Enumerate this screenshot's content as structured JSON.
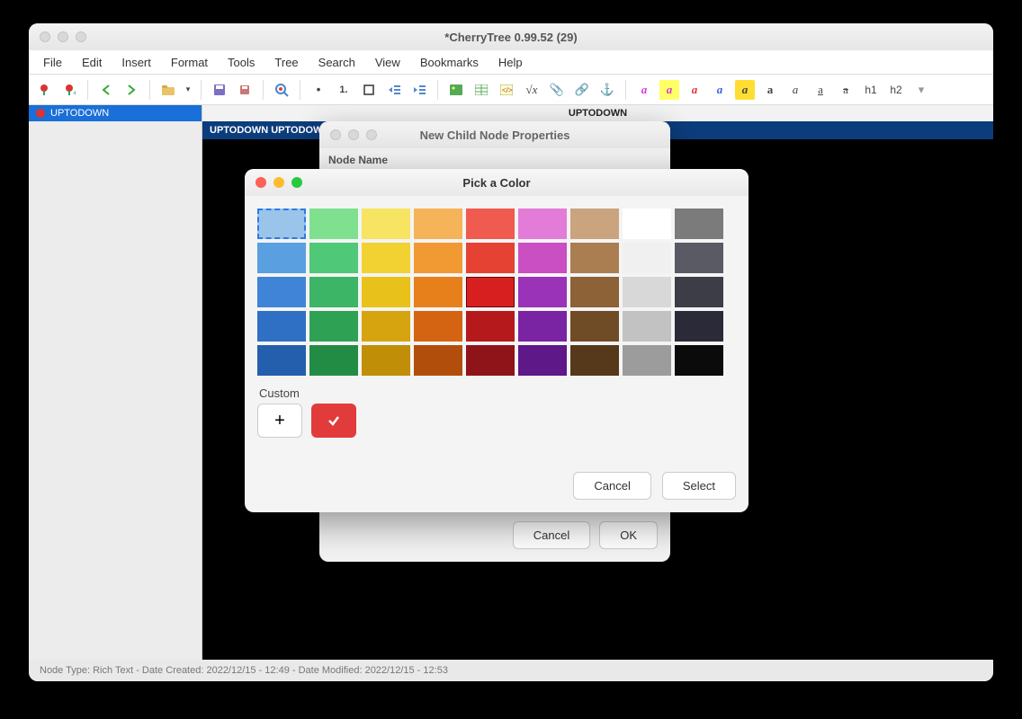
{
  "window": {
    "title": "*CherryTree 0.99.52 (29)"
  },
  "menu": [
    "File",
    "Edit",
    "Insert",
    "Format",
    "Tools",
    "Tree",
    "Search",
    "View",
    "Bookmarks",
    "Help"
  ],
  "sidebar": {
    "item": "UPTODOWN"
  },
  "tabheader": "UPTODOWN",
  "doctitle": "UPTODOWN UPTODOWN UPTODOWN",
  "status": "Node Type: Rich Text  -  Date Created: 2022/12/15 - 12:49  -  Date Modified: 2022/12/15 - 12:53",
  "dialog1": {
    "title": "New Child Node Properties",
    "nodeNameLabel": "Node Name",
    "cancel": "Cancel",
    "ok": "OK"
  },
  "dialog2": {
    "title": "Pick a Color",
    "customLabel": "Custom",
    "cancel": "Cancel",
    "select": "Select"
  },
  "toolbar": {
    "h1": "h1",
    "h2": "h2",
    "bullet": "•",
    "num": "1."
  },
  "palette": [
    [
      "#9bc4eb",
      "#7fe08f",
      "#f7e463",
      "#f5b459",
      "#ef5b4f",
      "#e27cd8",
      "#c9a47e",
      "#ffffff",
      "#7b7b7b"
    ],
    [
      "#5a9fe0",
      "#4fc877",
      "#f2d233",
      "#f19a33",
      "#e64234",
      "#c94fc3",
      "#ab7e52",
      "#f0f0f0",
      "#5a5a65"
    ],
    [
      "#3f84d6",
      "#3cb566",
      "#e8c11a",
      "#e77f1a",
      "#d81f1f",
      "#9a33b8",
      "#8d6236",
      "#d8d8d8",
      "#3d3d48"
    ],
    [
      "#2f6fc4",
      "#2fa154",
      "#d6a40e",
      "#d46412",
      "#b5191c",
      "#7a23a3",
      "#704c26",
      "#c2c2c2",
      "#2a2a38"
    ],
    [
      "#245fad",
      "#238c44",
      "#c18e07",
      "#b24e0c",
      "#8f1419",
      "#5e1887",
      "#56391a",
      "#9c9c9c",
      "#0b0b0b"
    ]
  ]
}
